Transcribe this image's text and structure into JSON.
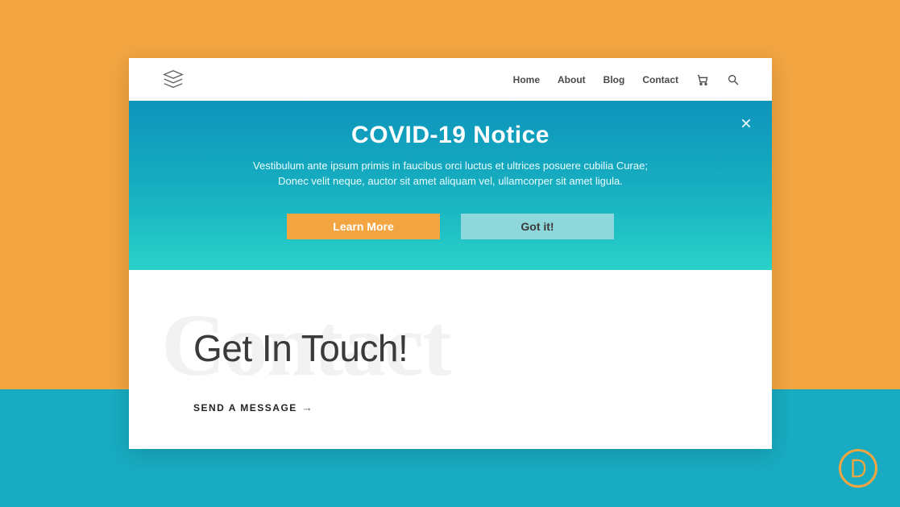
{
  "nav": {
    "items": [
      "Home",
      "About",
      "Blog",
      "Contact"
    ]
  },
  "notice": {
    "title": "COVID-19 Notice",
    "body": "Vestibulum ante ipsum primis in faucibus orci luctus et ultrices posuere cubilia Curae; Donec velit neque, auctor sit amet aliquam vel, ullamcorper sit amet ligula.",
    "primary_btn": "Learn More",
    "secondary_btn": "Got it!"
  },
  "content": {
    "ghost": "Contact",
    "heading": "Get In Touch!",
    "cta": "SEND A MESSAGE"
  },
  "badge_letter": "D"
}
